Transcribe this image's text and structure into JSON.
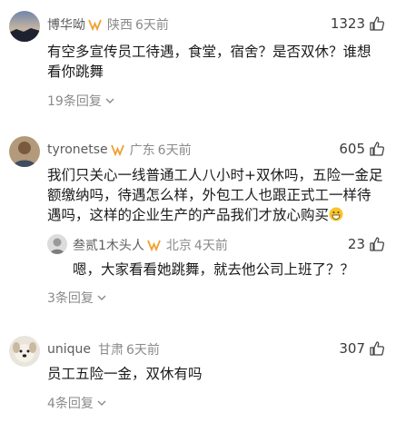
{
  "comments": [
    {
      "username": "博华呦",
      "location": "陕西",
      "time": "6天前",
      "likes": "1323",
      "text": "有空多宣传员工待遇，食堂，宿舍？是否双休？谁想看你跳舞",
      "replies_label": "19条回复",
      "avatar_icon": "sunset-landscape-avatar"
    },
    {
      "username": "tyronetse",
      "location": "广东",
      "time": "6天前",
      "likes": "605",
      "text": "我们只关心一线普通工人八小时+双休吗，五险一金足额缴纳吗，待遇怎么样，外包工人也跟正式工一样待遇吗，这样的企业生产的产品我们才放心购买",
      "emoji_icon": "grinning-emoji",
      "replies_label": "3条回复",
      "avatar_icon": "person-avatar",
      "reply": {
        "username": "叁贰1木头人",
        "location": "北京",
        "time": "4天前",
        "likes": "23",
        "text": "嗯，大家看看她跳舞，就去他公司上班了？？"
      }
    },
    {
      "username": "unique",
      "location": "甘肃",
      "time": "6天前",
      "likes": "307",
      "text": "员工五险一金，双休有吗",
      "replies_label": "4条回复",
      "avatar_icon": "dog-avatar"
    }
  ],
  "colors": {
    "username": "#5c5c5c",
    "meta": "#8a8a8a",
    "badge": "#f0a030",
    "text": "#1a1a1a"
  }
}
